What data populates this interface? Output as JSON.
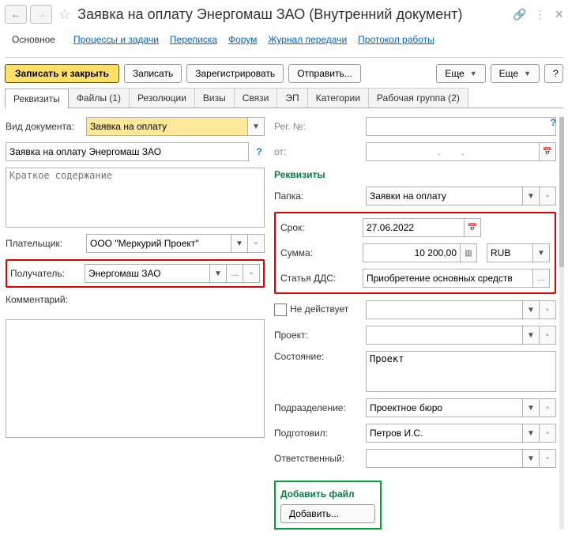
{
  "titlebar": {
    "title": "Заявка на оплату Энергомаш ЗАО (Внутренний документ)"
  },
  "nav": {
    "main": "Основное",
    "processes": "Процессы и задачи",
    "correspondence": "Переписка",
    "forum": "Форум",
    "journal": "Журнал передачи",
    "protocol": "Протокол работы"
  },
  "toolbar": {
    "save_close": "Записать и закрыть",
    "save": "Записать",
    "register": "Зарегистрировать",
    "send": "Отправить...",
    "more1": "Еще",
    "more2": "Еще",
    "help": "?"
  },
  "tabs": {
    "t1": "Реквизиты",
    "t2": "Файлы (1)",
    "t3": "Резолюции",
    "t4": "Визы",
    "t5": "Связи",
    "t6": "ЭП",
    "t7": "Категории",
    "t8": "Рабочая группа (2)"
  },
  "left": {
    "doc_type_label": "Вид документа:",
    "doc_type_value": "Заявка на оплату",
    "subject_value": "Заявка на оплату Энергомаш ЗАО",
    "summary_placeholder": "Краткое содержание",
    "payer_label": "Плательщик:",
    "payer_value": "ООО \"Меркурий Проект\"",
    "recipient_label": "Получатель:",
    "recipient_value": "Энергомаш ЗАО",
    "comment_label": "Комментарий:"
  },
  "right": {
    "regno_label": "Рег. №:",
    "from_label": "от:",
    "from_value": ".   .",
    "section": "Реквизиты",
    "folder_label": "Папка:",
    "folder_value": "Заявки на оплату",
    "due_label": "Срок:",
    "due_value": "27.06.2022",
    "sum_label": "Сумма:",
    "sum_value": "10 200,00",
    "currency": "RUB",
    "dds_label": "Статья ДДС:",
    "dds_value": "Приобретение основных средств",
    "inactive_label": "Не действует",
    "project_label": "Проект:",
    "status_label": "Состояние:",
    "status_value": "Проект",
    "dept_label": "Подразделение:",
    "dept_value": "Проектное бюро",
    "prepared_label": "Подготовил:",
    "prepared_value": "Петров И.С.",
    "responsible_label": "Ответственный:",
    "addfile_title": "Добавить файл",
    "addfile_btn": "Добавить..."
  },
  "help_q": "?"
}
